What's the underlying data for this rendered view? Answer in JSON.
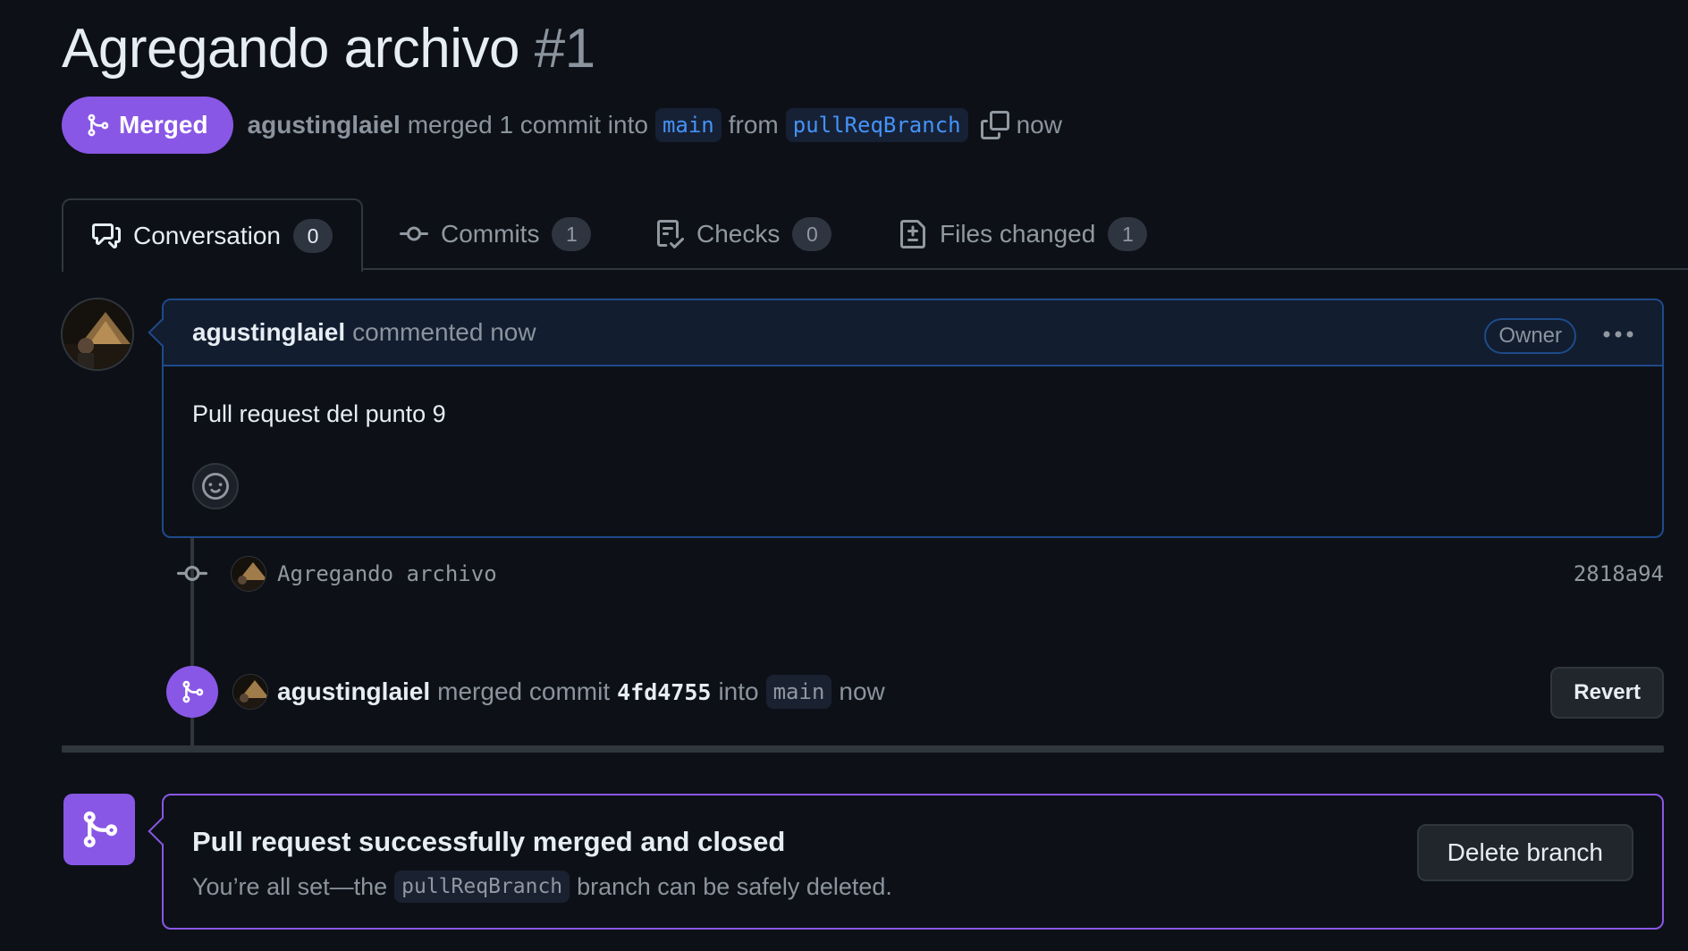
{
  "pr": {
    "title": "Agregando archivo",
    "number": "#1",
    "state_label": "Merged",
    "author": "agustinglaiel",
    "merge_text": "merged 1 commit into",
    "base_branch": "main",
    "from_text": "from",
    "head_branch": "pullReqBranch",
    "time": "now"
  },
  "tabs": [
    {
      "label": "Conversation",
      "count": "0"
    },
    {
      "label": "Commits",
      "count": "1"
    },
    {
      "label": "Checks",
      "count": "0"
    },
    {
      "label": "Files changed",
      "count": "1"
    }
  ],
  "comment": {
    "author": "agustinglaiel",
    "action": "commented now",
    "role_badge": "Owner",
    "body": "Pull request del punto 9"
  },
  "commit": {
    "message": "Agregando archivo",
    "sha": "2818a94"
  },
  "merge_event": {
    "author": "agustinglaiel",
    "text_before": "merged commit",
    "sha": "4fd4755",
    "text_into": "into",
    "branch": "main",
    "time": "now",
    "revert_label": "Revert"
  },
  "merged_box": {
    "title": "Pull request successfully merged and closed",
    "sub_before": "You’re all set—the",
    "branch": "pullReqBranch",
    "sub_after": "branch can be safely deleted.",
    "delete_label": "Delete branch"
  },
  "colors": {
    "background": "#0d1117",
    "merged_purple": "#8957e5",
    "accent_blue": "#4493f8",
    "border": "#30363d"
  }
}
